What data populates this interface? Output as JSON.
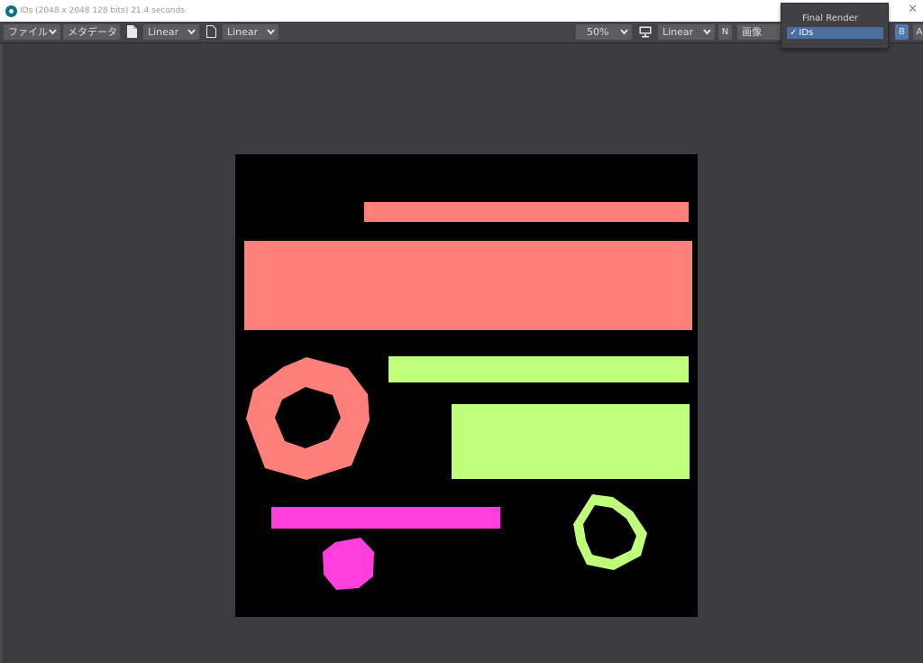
{
  "window": {
    "title": "IDs (2048 x 2048 128 bits) 21.4 seconds",
    "close_glyph": "✕"
  },
  "toolbar": {
    "file_menu": "ファイル",
    "metadata_button": "メタデータ",
    "input_colorspace": "Linear",
    "output_colorspace": "Linear",
    "zoom": "50%",
    "display_colorspace": "Linear",
    "n_button": "N",
    "layer_select": "画像",
    "b_button": "B",
    "a_button": "A"
  },
  "render_popup": {
    "items": [
      {
        "label": "Final Render",
        "selected": false
      },
      {
        "label": "IDs",
        "selected": true,
        "check": "✓"
      }
    ]
  },
  "render": {
    "colors": {
      "salmon": "#ff7f7a",
      "lime": "#bfff7a",
      "magenta": "#ff3fdd",
      "background": "#000000"
    },
    "shapes": [
      "bar",
      "bar",
      "octagon-ring",
      "bar",
      "bar",
      "bar",
      "octagon",
      "octagon-ring"
    ]
  }
}
